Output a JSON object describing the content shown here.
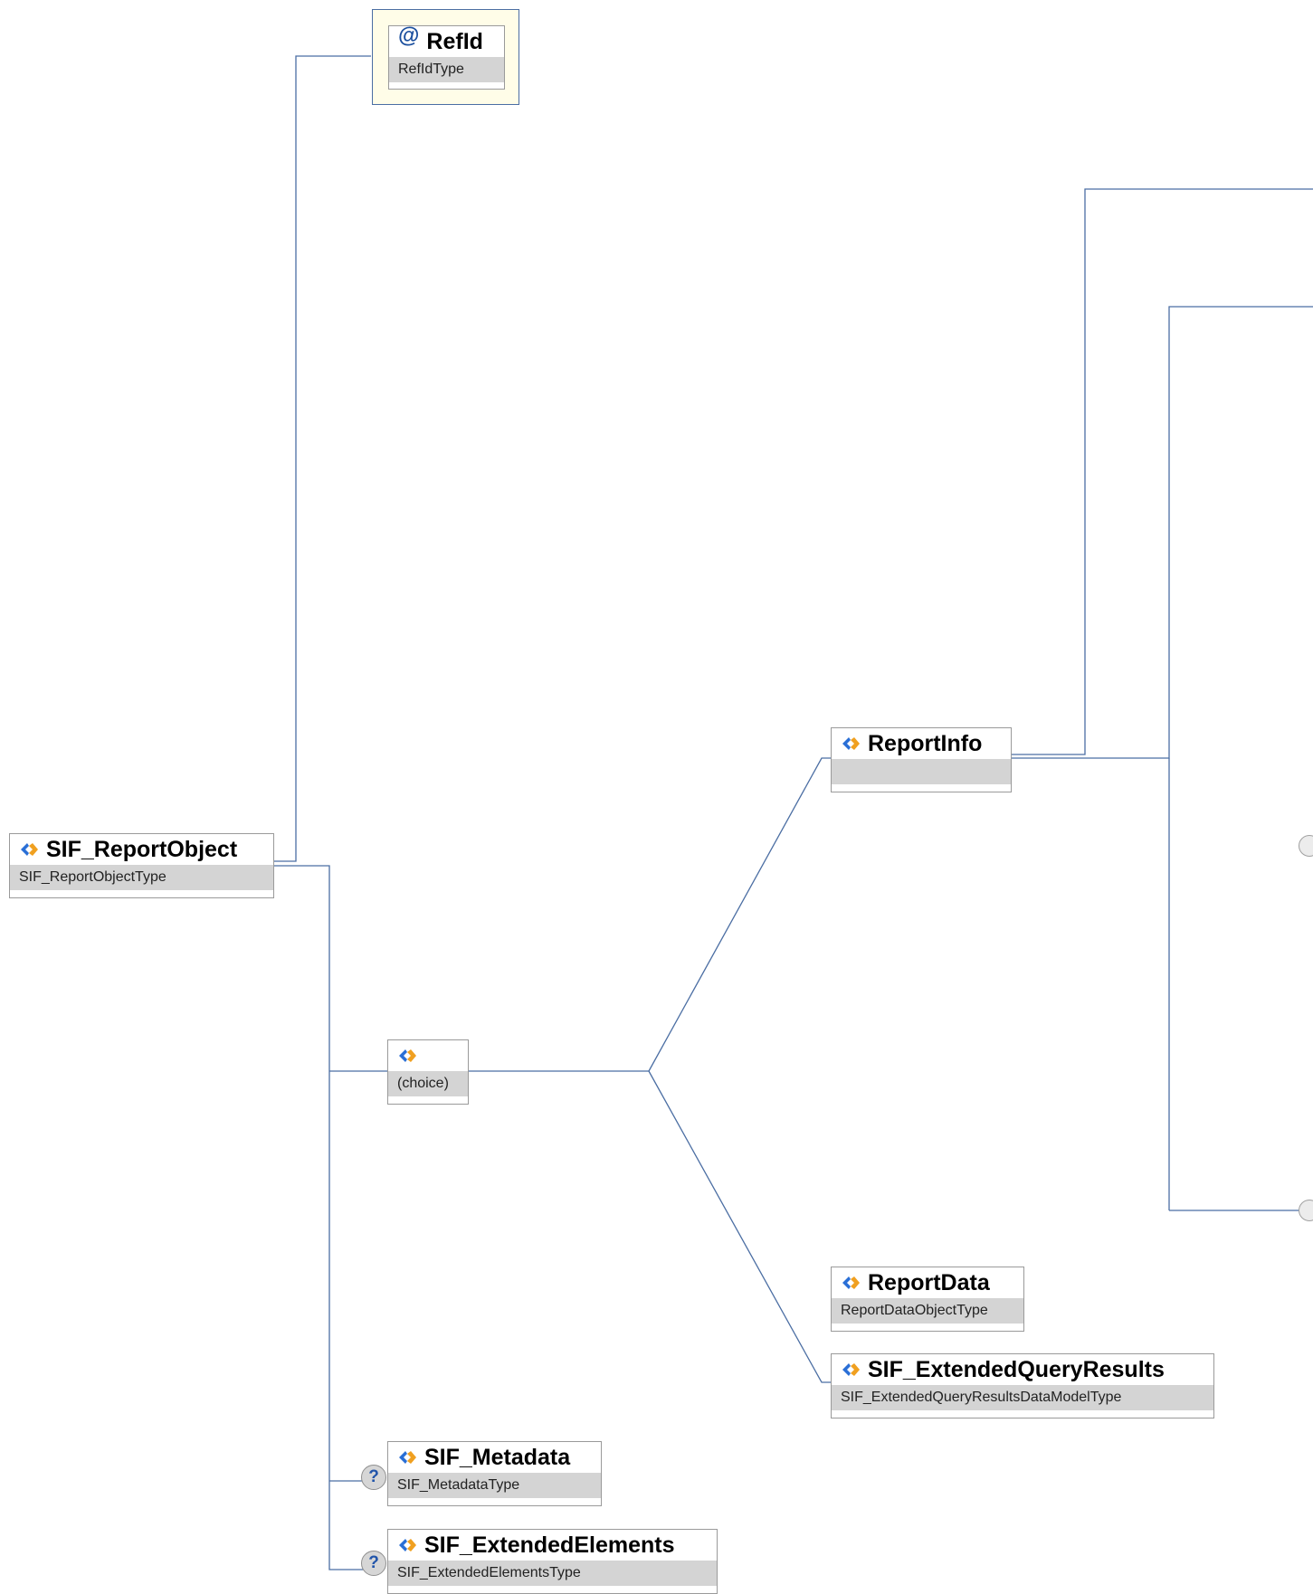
{
  "diagram": {
    "nodes": {
      "refid": {
        "name": "RefId",
        "type": "RefIdType",
        "kind": "attribute"
      },
      "root": {
        "name": "SIF_ReportObject",
        "type": "SIF_ReportObjectType"
      },
      "choice": {
        "name": "",
        "type": "(choice)"
      },
      "reportinfo": {
        "name": "ReportInfo",
        "type": ""
      },
      "reportdata": {
        "name": "ReportData",
        "type": "ReportDataObjectType"
      },
      "extquery": {
        "name": "SIF_ExtendedQueryResults",
        "type": "SIF_ExtendedQueryResultsDataModelType"
      },
      "metadata": {
        "name": "SIF_Metadata",
        "type": "SIF_MetadataType",
        "optional": true
      },
      "extelements": {
        "name": "SIF_ExtendedElements",
        "type": "SIF_ExtendedElementsType",
        "optional": true
      }
    },
    "optional_marker": "?",
    "colors": {
      "connector": "#4b6ea3",
      "type_band": "#d4d4d4",
      "node_border": "#9a9a9a",
      "attribute_bg": "#fffde8",
      "icon_blue": "#2a6fd6",
      "icon_orange": "#f0a020"
    },
    "icons": {
      "element": "element-diamond-icon",
      "attribute": "at-sign-icon",
      "optional": "question-mark-icon"
    }
  }
}
